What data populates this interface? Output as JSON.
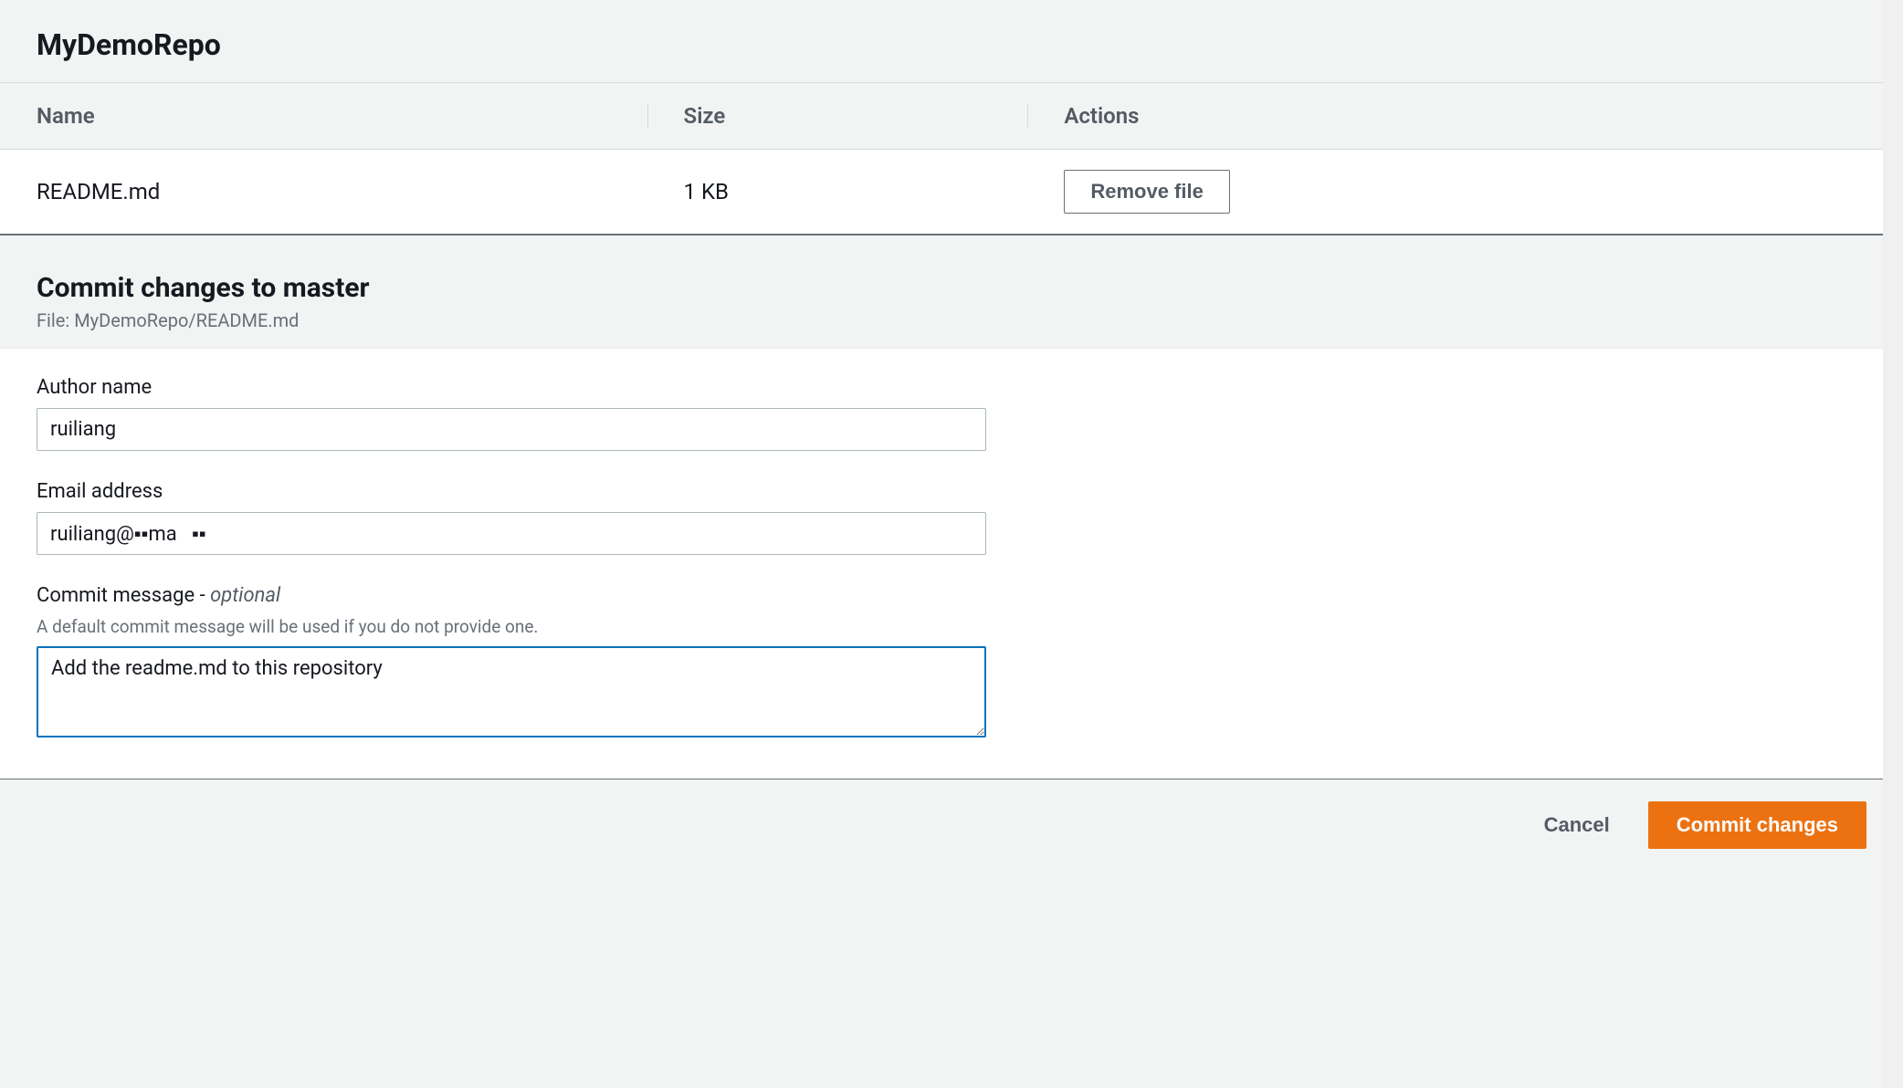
{
  "header": {
    "repo_name": "MyDemoRepo"
  },
  "file_table": {
    "columns": {
      "name": "Name",
      "size": "Size",
      "actions": "Actions"
    },
    "rows": [
      {
        "name": "README.md",
        "size": "1 KB",
        "action_label": "Remove file"
      }
    ]
  },
  "commit_section": {
    "title": "Commit changes to master",
    "file_prefix": "File: ",
    "file_path": "MyDemoRepo/README.md"
  },
  "form": {
    "author": {
      "label": "Author name",
      "value": "ruiliang"
    },
    "email": {
      "label": "Email address",
      "value": "ruiliang@▪▪ma   ▪▪"
    },
    "message": {
      "label_text": "Commit message ",
      "label_dash": "- ",
      "label_optional": "optional",
      "help": "A default commit message will be used if you do not provide one.",
      "value": "Add the readme.md to this repository"
    }
  },
  "footer": {
    "cancel": "Cancel",
    "commit": "Commit changes"
  }
}
